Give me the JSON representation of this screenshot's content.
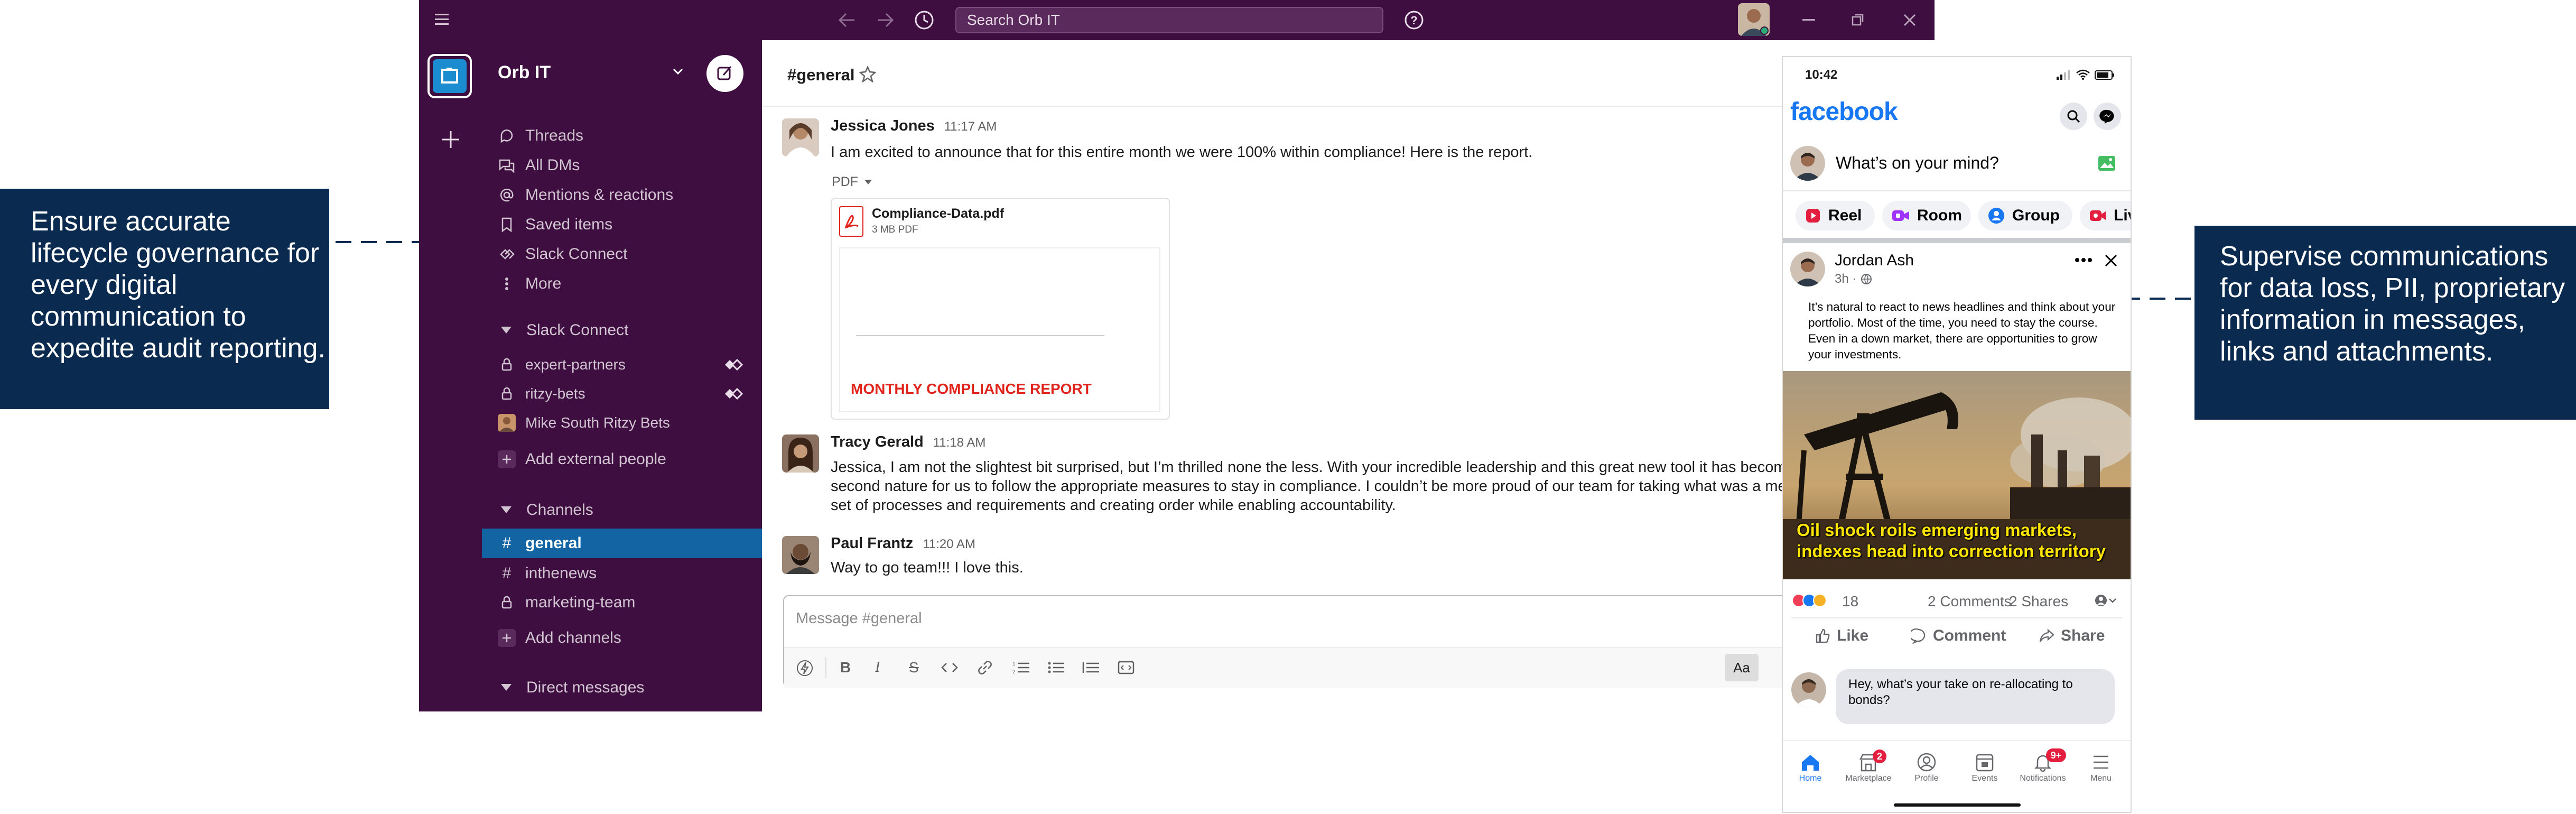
{
  "callouts": {
    "left": "Ensure accurate lifecycle governance for every digital communication to expedite audit reporting.",
    "right": "Supervise communications for data loss, PII, proprietary information in messages, links and attachments."
  },
  "slack": {
    "search_placeholder": "Search Orb IT",
    "workspace_name": "Orb IT",
    "nav": {
      "threads": "Threads",
      "all_dms": "All DMs",
      "mentions": "Mentions & reactions",
      "saved": "Saved items",
      "slack_connect": "Slack Connect",
      "more": "More"
    },
    "slack_connect_section": {
      "title": "Slack Connect",
      "items": [
        "expert-partners",
        "ritzy-bets",
        "Mike South Ritzy Bets"
      ],
      "add": "Add external people"
    },
    "channels_section": {
      "title": "Channels",
      "items": [
        "general",
        "inthenews",
        "marketing-team"
      ],
      "add": "Add channels"
    },
    "dms_section": {
      "title": "Direct messages"
    },
    "channel_title": "#general",
    "messages": [
      {
        "name": "Jessica Jones",
        "time": "11:17 AM",
        "text": "I am excited to announce that for this entire month we were 100% within compliance! Here is the report."
      },
      {
        "name": "Tracy Gerald",
        "time": "11:18 AM",
        "text": "Jessica, I am not the slightest bit surprised, but I’m thrilled none the less. With your incredible leadership and this great new tool it has become second nature for us to follow the appropriate measures to stay in compliance. I couldn’t be more proud of our team for taking what was a messy set of processes and requirements and creating order while enabling accountability."
      },
      {
        "name": "Paul Frantz",
        "time": "11:20 AM",
        "text": "Way to go team!!! I love this."
      }
    ],
    "attachment": {
      "type_label": "PDF",
      "file_name": "Compliance-Data.pdf",
      "file_meta": "3 MB PDF",
      "preview_title": "MONTHLY COMPLIANCE REPORT"
    },
    "composer": {
      "placeholder": "Message #general",
      "aa": "Aa"
    }
  },
  "facebook": {
    "status_time": "10:42",
    "logo": "facebook",
    "whats_on_mind": "What’s on your mind?",
    "pills": [
      "Reel",
      "Room",
      "Group",
      "Live"
    ],
    "post": {
      "author": "Jordan Ash",
      "meta": "3h ·",
      "text": "It’s natural to react to news headlines and think about your portfolio. Most of the time, you need to stay the course. Even in a down market, there are opportunities to grow your investments.",
      "image_caption_line1": "Oil shock roils emerging markets,",
      "image_caption_line2": "indexes head into correction territory",
      "reaction_count": "18",
      "comments": "2 Comments",
      "shares": "2 Shares",
      "actions": [
        "Like",
        "Comment",
        "Share"
      ],
      "comment_text": "Hey, what’s your take on re-allocating to bonds?"
    },
    "tabs": [
      {
        "label": "Home",
        "badge": ""
      },
      {
        "label": "Marketplace",
        "badge": "2"
      },
      {
        "label": "Profile",
        "badge": ""
      },
      {
        "label": "Events",
        "badge": ""
      },
      {
        "label": "Notifications",
        "badge": "9+"
      },
      {
        "label": "Menu",
        "badge": ""
      }
    ],
    "colors": {
      "brand": "#1877f2"
    }
  }
}
